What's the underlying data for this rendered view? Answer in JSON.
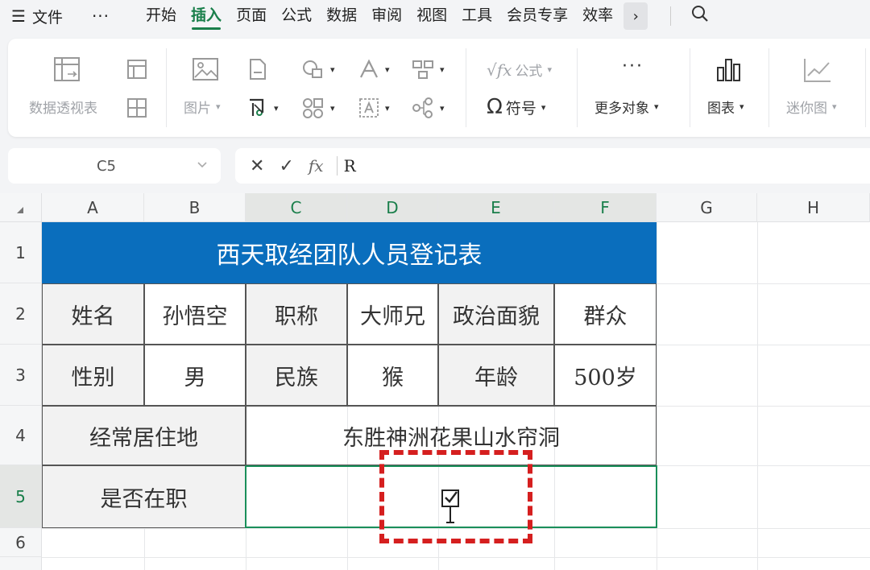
{
  "menu": {
    "file_label": "文件",
    "more_label": "···",
    "tabs": [
      "开始",
      "插入",
      "页面",
      "公式",
      "数据",
      "审阅",
      "视图",
      "工具",
      "会员专享",
      "效率"
    ],
    "active_tab": "插入",
    "chevron": "›"
  },
  "ribbon": {
    "pivot_label": "数据透视表",
    "picture_label": "图片",
    "formula_label": "公式",
    "symbol_label": "符号",
    "more_objects_label": "更多对象",
    "chart_label": "图表",
    "sparkline_label": "迷你图"
  },
  "formula_bar": {
    "cell_ref": "C5",
    "cancel": "✕",
    "confirm": "✓",
    "fx": "fx",
    "value": "R"
  },
  "sheet": {
    "columns": [
      "A",
      "B",
      "C",
      "D",
      "E",
      "F",
      "G",
      "H"
    ],
    "rows": [
      "1",
      "2",
      "3",
      "4",
      "5",
      "6"
    ],
    "selected_column_range": [
      "C",
      "D",
      "E",
      "F"
    ],
    "selected_row": "5",
    "title": "西天取经团队人员登记表",
    "r2": [
      "姓名",
      "孙悟空",
      "职称",
      "大师兄",
      "政治面貌",
      "群众"
    ],
    "r3": [
      "性别",
      "男",
      "民族",
      "猴",
      "年龄",
      "500岁"
    ],
    "r4": [
      "经常居住地",
      "东胜神洲花果山水帘洞"
    ],
    "r5": [
      "是否在职"
    ],
    "header_color": "#0a6ebd",
    "highlight_color": "#d51f1f"
  }
}
